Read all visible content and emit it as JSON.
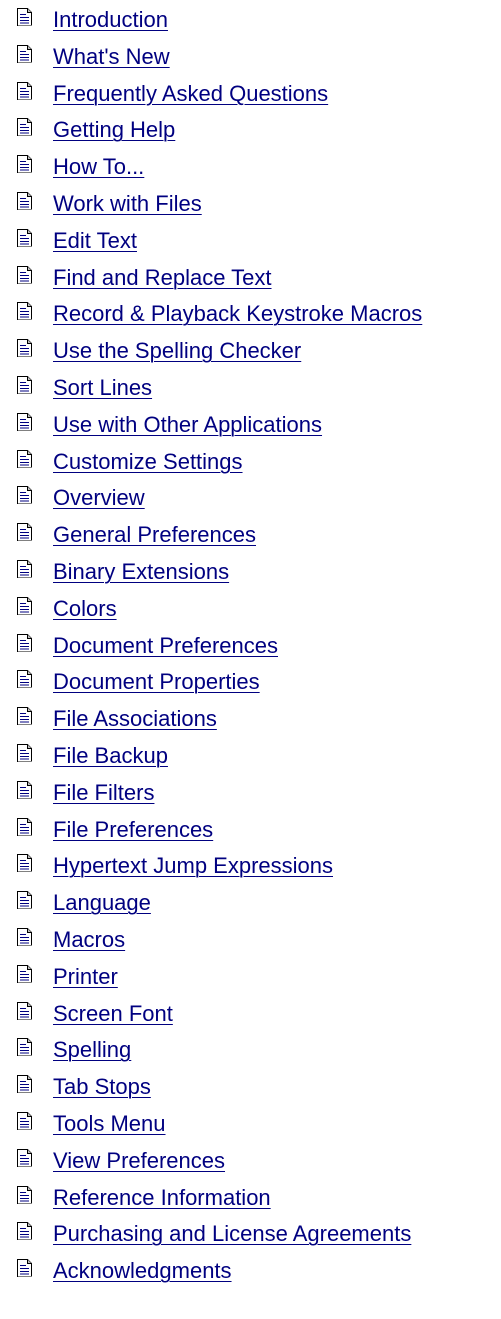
{
  "icon": "help-topic-page-icon",
  "colors": {
    "link": "#000080",
    "icon_lines": "#000080",
    "icon_fold": "#808080",
    "background": "#ffffff"
  },
  "topics": [
    "Introduction",
    "What's New",
    "Frequently Asked Questions",
    "Getting Help",
    "How To...",
    "Work with Files",
    "Edit Text",
    "Find and Replace Text",
    "Record & Playback Keystroke Macros",
    "Use the Spelling Checker",
    "Sort Lines",
    "Use with Other Applications",
    "Customize Settings",
    "Overview",
    "General Preferences",
    "Binary Extensions",
    "Colors",
    "Document Preferences",
    "Document Properties",
    "File Associations",
    "File Backup",
    "File Filters",
    "File Preferences",
    "Hypertext Jump Expressions",
    "Language",
    "Macros",
    "Printer",
    "Screen Font",
    "Spelling",
    "Tab Stops",
    "Tools Menu",
    "View Preferences",
    "Reference Information",
    "Purchasing and License Agreements",
    "Acknowledgments"
  ]
}
